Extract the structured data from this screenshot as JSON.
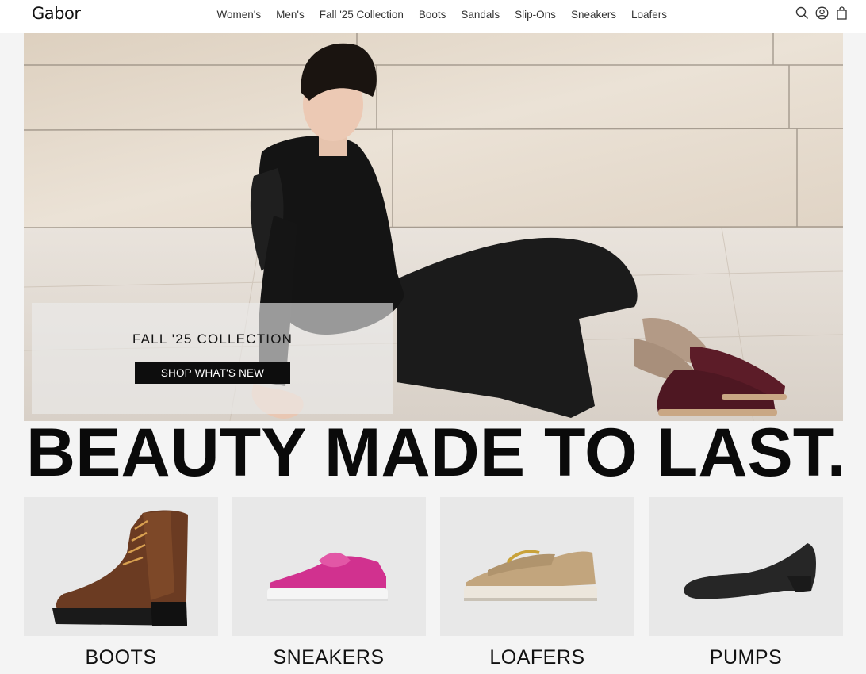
{
  "header": {
    "logo": "Gabor",
    "nav": [
      "Women's",
      "Men's",
      "Fall '25 Collection",
      "Boots",
      "Sandals",
      "Slip-Ons",
      "Sneakers",
      "Loafers"
    ],
    "icons": [
      "search-icon",
      "account-icon",
      "bag-icon"
    ]
  },
  "hero": {
    "promo_title": "FALL '25 COLLECTION",
    "promo_button": "SHOP WHAT'S NEW"
  },
  "headline": "BEAUTY MADE TO LAST.",
  "categories": [
    {
      "label": "BOOTS",
      "image": "brown-lace-up-boot"
    },
    {
      "label": "SNEAKERS",
      "image": "pink-sneaker"
    },
    {
      "label": "LOAFERS",
      "image": "beige-chain-loafer"
    },
    {
      "label": "PUMPS",
      "image": "black-wedge-pump"
    }
  ]
}
